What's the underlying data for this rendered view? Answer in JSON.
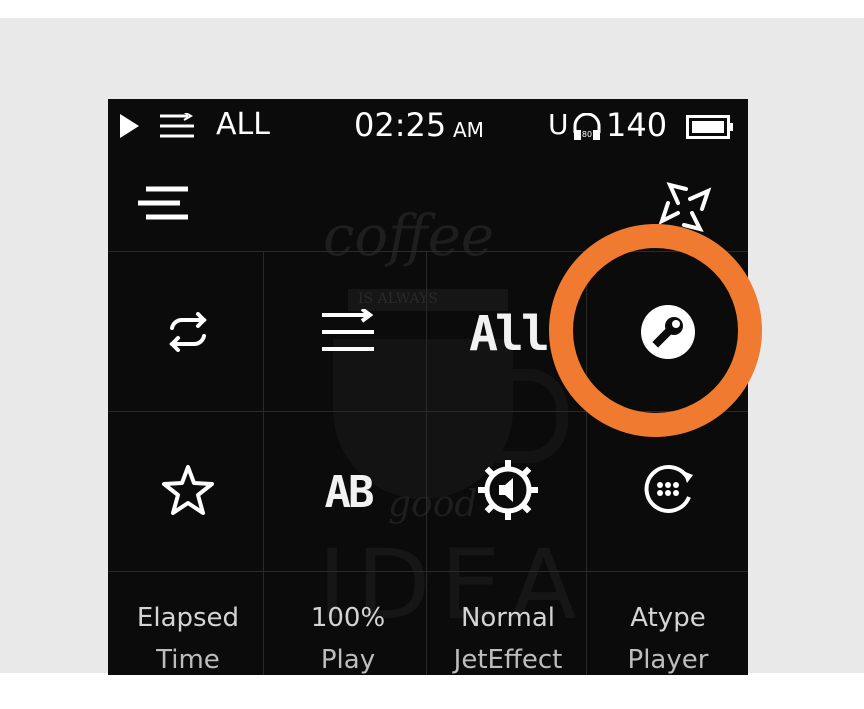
{
  "status_bar": {
    "repeat_mode": "ALL",
    "time": "02:25",
    "am_pm": "AM",
    "volume_prefix": "U",
    "volume": "140",
    "play_icon": "play-icon",
    "list_icon": "list-order-icon",
    "headphone_icon": "headphone-icon",
    "battery_icon": "battery-icon"
  },
  "header": {
    "menu_icon": "menu-lines-icon",
    "pinwheel_icon": "pinwheel-icon"
  },
  "quick_settings": {
    "row1": [
      {
        "icon": "repeat-icon"
      },
      {
        "icon": "order-icon"
      },
      {
        "icon": "all-repeat-icon",
        "text": "All"
      },
      {
        "icon": "wrench-settings-icon"
      }
    ],
    "row2": [
      {
        "icon": "star-icon"
      },
      {
        "icon": "ab-repeat-icon",
        "text": "AB"
      },
      {
        "icon": "speaker-gear-icon"
      },
      {
        "icon": "dial-pad-rotate-icon"
      }
    ],
    "row3": [
      {
        "line1": "Elapsed",
        "line2": "Time"
      },
      {
        "line1": "100%",
        "line2": "Play"
      },
      {
        "line1": "Normal",
        "line2": "JetEffect"
      },
      {
        "line1": "Atype",
        "line2": "Player"
      }
    ]
  },
  "wallpaper_text": {
    "word1": "coffee",
    "word2": "IS ALWAYS",
    "word3": "good",
    "word4": "IDEA"
  },
  "colors": {
    "highlight_ring": "#f07a30",
    "screen_background": "#0b0b0b",
    "page_band": "#e9e9e9"
  }
}
